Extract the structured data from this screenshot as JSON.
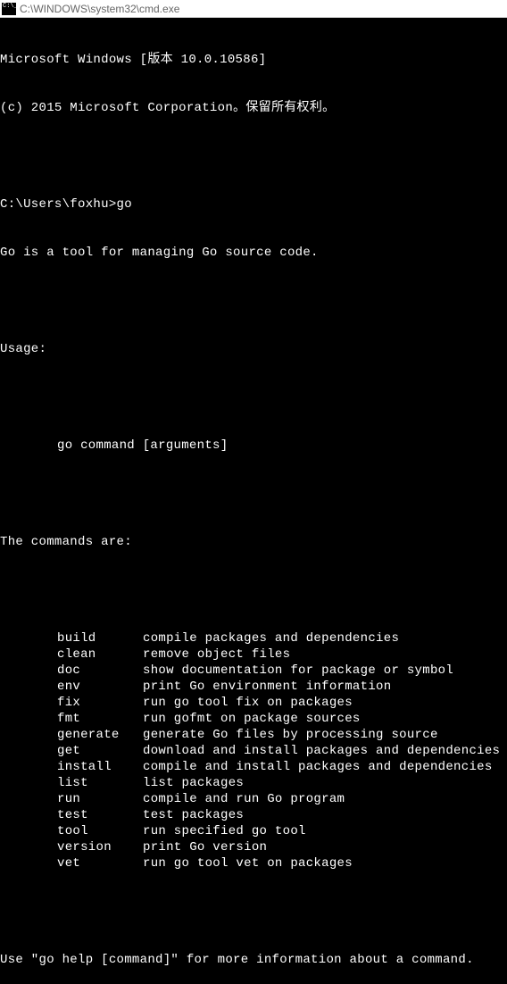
{
  "titlebar": {
    "text": "C:\\WINDOWS\\system32\\cmd.exe"
  },
  "header": {
    "line1": "Microsoft Windows [版本 10.0.10586]",
    "line2": "(c) 2015 Microsoft Corporation。保留所有权利。"
  },
  "prompt": {
    "path": "C:\\Users\\foxhu>",
    "command": "go"
  },
  "output": {
    "intro": "Go is a tool for managing Go source code.",
    "usage_label": "Usage:",
    "usage_text": "go command [arguments]",
    "commands_label": "The commands are:",
    "help_footer": "Use \"go help [command]\" for more information about a command."
  },
  "commands": [
    {
      "name": "build",
      "desc": "compile packages and dependencies"
    },
    {
      "name": "clean",
      "desc": "remove object files"
    },
    {
      "name": "doc",
      "desc": "show documentation for package or symbol"
    },
    {
      "name": "env",
      "desc": "print Go environment information"
    },
    {
      "name": "fix",
      "desc": "run go tool fix on packages"
    },
    {
      "name": "fmt",
      "desc": "run gofmt on package sources"
    },
    {
      "name": "generate",
      "desc": "generate Go files by processing source"
    },
    {
      "name": "get",
      "desc": "download and install packages and dependencies"
    },
    {
      "name": "install",
      "desc": "compile and install packages and dependencies"
    },
    {
      "name": "list",
      "desc": "list packages"
    },
    {
      "name": "run",
      "desc": "compile and run Go program"
    },
    {
      "name": "test",
      "desc": "test packages"
    },
    {
      "name": "tool",
      "desc": "run specified go tool"
    },
    {
      "name": "version",
      "desc": "print Go version"
    },
    {
      "name": "vet",
      "desc": "run go tool vet on packages"
    }
  ]
}
